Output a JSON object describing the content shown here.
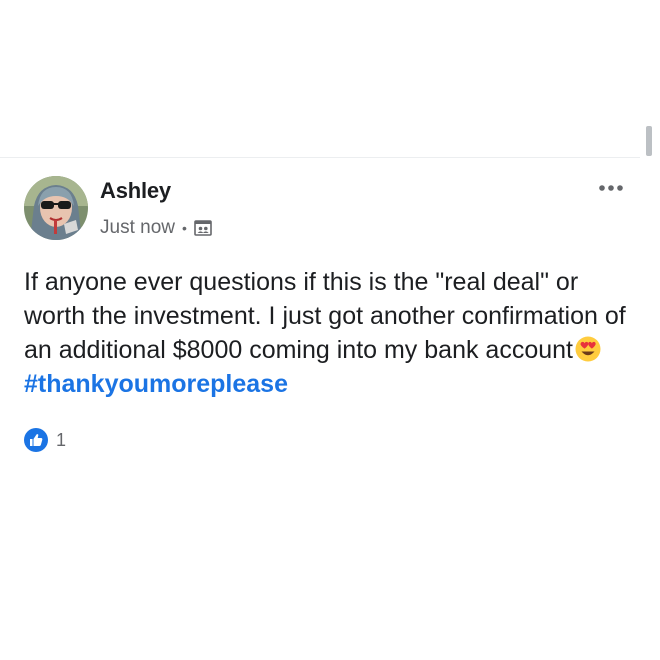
{
  "post": {
    "author": "Ashley",
    "timestamp": "Just now",
    "separator": "•",
    "privacy_icon": "friends-icon",
    "menu_icon": "more-horizontal-icon",
    "text_before_emoji": "If anyone ever questions if this is the \"real deal\" or worth the investment. I just got another confirmation of an additional $8000 coming into my bank account",
    "emoji_icon": "heart-eyes-emoji",
    "hashtag": "#thankyoumoreplease",
    "reaction_icon": "like-icon",
    "reaction_count": "1"
  },
  "colors": {
    "author_text": "#1c1e21",
    "meta_text": "#65676b",
    "hashtag": "#1b74e4",
    "like_badge": "#1b74e4",
    "divider": "#eceef0",
    "scrollbar": "#bcc0c4"
  }
}
